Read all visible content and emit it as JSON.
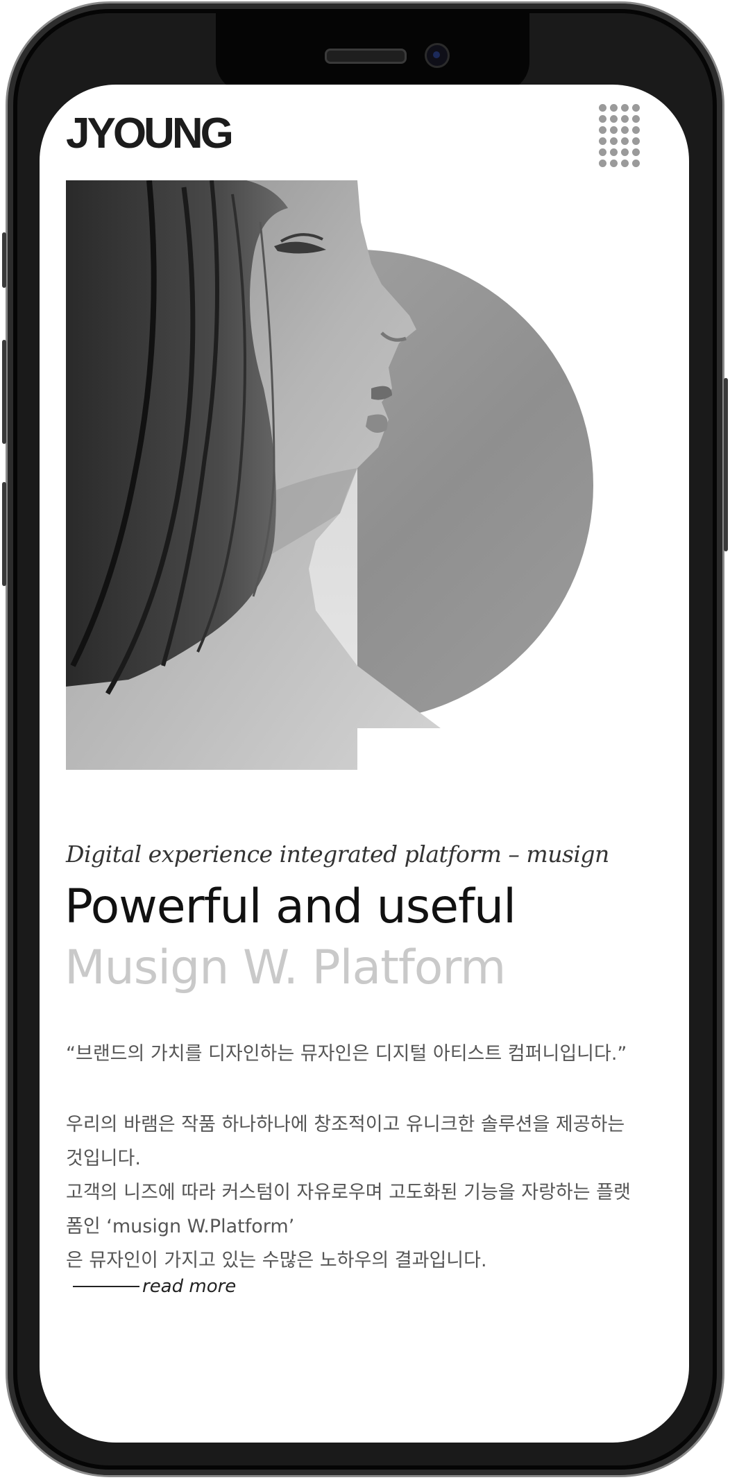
{
  "header": {
    "logo_text": "JYOUNG",
    "menu_icon": "dot-grid-menu-icon"
  },
  "hero": {
    "image_description_icon": "portrait-image"
  },
  "intro": {
    "tagline": "Digital experience integrated platform – musign",
    "headline": "Powerful and useful",
    "subheadline": "Musign W. Platform",
    "quote": "“브랜드의 가치를 디자인하는 뮤자인은 디지털 아티스트 컴퍼니입니다.”",
    "paragraphs": [
      "우리의 바램은 작품 하나하나에 창조적이고 유니크한 솔루션을 제공하는 것입니다.",
      "고객의 니즈에 따라 커스텀이 자유로우며 고도화된 기능을 자랑하는 플랫폼인 ‘musign W.Platform’",
      "은 뮤자인이 가지고 있는 수많은 노하우의 결과입니다."
    ],
    "read_more": "read more"
  },
  "colors": {
    "text_dark": "#111111",
    "text_light": "#c9c9c9",
    "body_text": "#555555",
    "frame": "#1a1a1a"
  }
}
